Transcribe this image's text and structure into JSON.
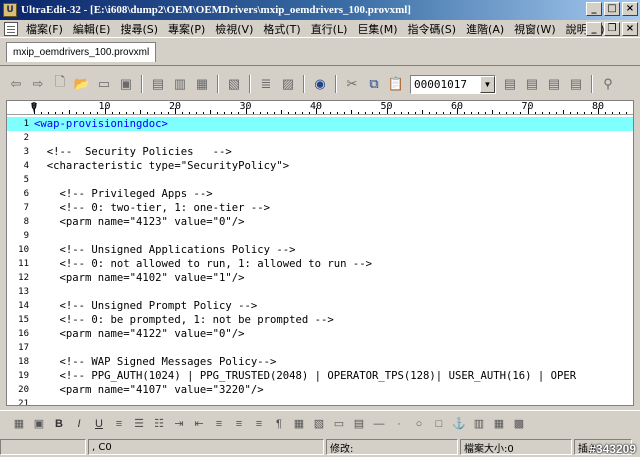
{
  "window": {
    "title": "UltraEdit-32 - [E:\\i608\\dump2\\OEM\\OEMDrivers\\mxip_oemdrivers_100.provxml]",
    "icon": "ultraedit-app-icon"
  },
  "menu": {
    "items": [
      "檔案(F)",
      "編輯(E)",
      "搜尋(S)",
      "專案(P)",
      "檢視(V)",
      "格式(T)",
      "直行(L)",
      "巨集(M)",
      "指令碼(S)",
      "進階(A)",
      "視窗(W)",
      "說明(H)"
    ]
  },
  "tabs": [
    {
      "label": "mxip_oemdrivers_100.provxml",
      "active": true
    }
  ],
  "toolbar": {
    "combo_value": "00001017",
    "buttons": [
      "back",
      "forward",
      "new",
      "open",
      "close",
      "save",
      "save-all",
      "print",
      "print-preview",
      "spell",
      "web",
      "copy",
      "paste",
      "find",
      "replace",
      "goto",
      "bookmark",
      "binoculars"
    ]
  },
  "ruler": {
    "labels": [
      "0",
      "10",
      "20",
      "30",
      "40",
      "50",
      "60",
      "70",
      "80"
    ]
  },
  "editor": {
    "lines": [
      {
        "n": "1",
        "text": "<wap-provisioningdoc>",
        "active": true
      },
      {
        "n": "2",
        "text": ""
      },
      {
        "n": "3",
        "text": "  <!--  Security Policies   -->"
      },
      {
        "n": "4",
        "text": "  <characteristic type=\"SecurityPolicy\">"
      },
      {
        "n": "5",
        "text": ""
      },
      {
        "n": "6",
        "text": "    <!-- Privileged Apps -->"
      },
      {
        "n": "7",
        "text": "    <!-- 0: two-tier, 1: one-tier -->"
      },
      {
        "n": "8",
        "text": "    <parm name=\"4123\" value=\"0\"/>"
      },
      {
        "n": "9",
        "text": ""
      },
      {
        "n": "10",
        "text": "    <!-- Unsigned Applications Policy -->"
      },
      {
        "n": "11",
        "text": "    <!-- 0: not allowed to run, 1: allowed to run -->"
      },
      {
        "n": "12",
        "text": "    <parm name=\"4102\" value=\"1\"/>"
      },
      {
        "n": "13",
        "text": ""
      },
      {
        "n": "14",
        "text": "    <!-- Unsigned Prompt Policy -->"
      },
      {
        "n": "15",
        "text": "    <!-- 0: be prompted, 1: not be prompted -->"
      },
      {
        "n": "16",
        "text": "    <parm name=\"4122\" value=\"0\"/>"
      },
      {
        "n": "17",
        "text": ""
      },
      {
        "n": "18",
        "text": "    <!-- WAP Signed Messages Policy-->"
      },
      {
        "n": "19",
        "text": "    <!-- PPG_AUTH(1024) | PPG_TRUSTED(2048) | OPERATOR_TPS(128)| USER_AUTH(16) | OPER"
      },
      {
        "n": "20",
        "text": "    <parm name=\"4107\" value=\"3220\"/>"
      },
      {
        "n": "21",
        "text": ""
      }
    ]
  },
  "statusbar": {
    "position": ", C0",
    "modified_label": "修改:",
    "filesize_label": "檔案大小:0",
    "extra": "插入",
    "watermark": "#343209"
  }
}
